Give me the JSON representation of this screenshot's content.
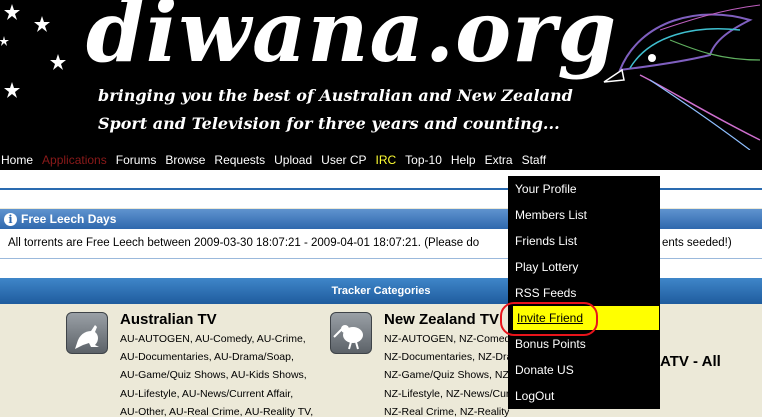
{
  "banner": {
    "logo": "diwana.org",
    "tagline_1": "bringing you the best of Australian and New Zealand",
    "tagline_2": "Sport and Television for three years and counting..."
  },
  "nav": {
    "items": [
      "Home",
      "Applications",
      "Forums",
      "Browse",
      "Requests",
      "Upload",
      "User CP",
      "IRC",
      "Top-10",
      "Help",
      "Extra",
      "Staff"
    ]
  },
  "leech": {
    "title": "Free Leech Days",
    "message": "All torrents are Free Leech between 2009-03-30 18:07:21 - 2009-04-01 18:07:21. (Please do",
    "message_tail": "ents seeded!)"
  },
  "categories": {
    "title": "Tracker Categories",
    "australian": {
      "title": "Australian TV",
      "lines": [
        "AU-AUTOGEN, AU-Comedy, AU-Crime,",
        "AU-Documentaries, AU-Drama/Soap,",
        "AU-Game/Quiz Shows, AU-Kids Shows,",
        "AU-Lifestyle, AU-News/Current Affair,",
        "AU-Other, AU-Real Crime, AU-Reality TV,"
      ]
    },
    "nz": {
      "title": "New Zealand TV",
      "lines": [
        "NZ-AUTOGEN, NZ-Comedy,",
        "NZ-Documentaries, NZ-Drama/Soap,",
        "NZ-Game/Quiz Shows, NZ-Kids,",
        "NZ-Lifestyle, NZ-News/Current Affair,",
        "NZ-Real Crime, NZ-Reality TV,"
      ]
    },
    "fta_partial": "ATV - All"
  },
  "extra_menu": {
    "items": [
      "Your Profile",
      "Members List",
      "Friends List",
      "Play Lottery",
      "RSS Feeds",
      "Invite Friend",
      "Bonus Points",
      "Donate US",
      "LogOut"
    ],
    "highlighted": "Invite Friend"
  },
  "colors": {
    "highlight": "#ffff00",
    "annotation": "#e8141b",
    "header_blue": "#2f68ad"
  }
}
